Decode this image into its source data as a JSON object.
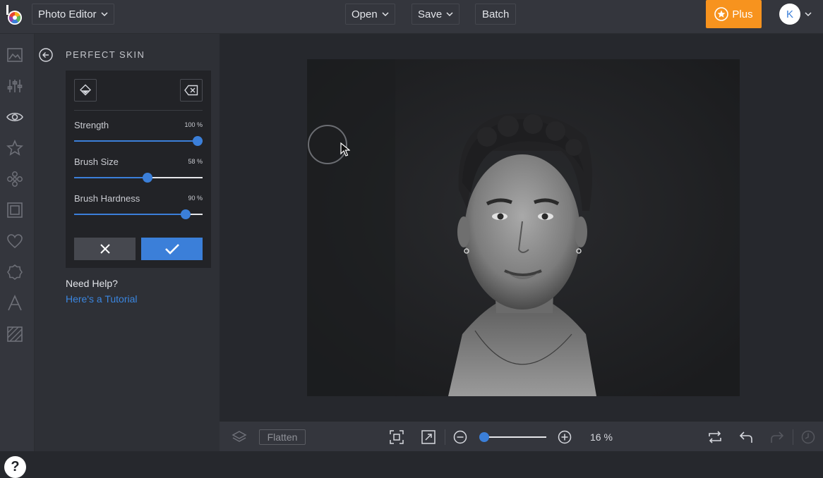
{
  "app": {
    "mode_label": "Photo Editor",
    "menu": {
      "open": "Open",
      "save": "Save",
      "batch": "Batch"
    },
    "plus_label": "Plus",
    "user_initial": "K"
  },
  "rail": {
    "icons": [
      "image-icon",
      "sliders-icon",
      "eye-icon",
      "star-icon",
      "flower-icon",
      "frame-icon",
      "heart-icon",
      "badge-icon",
      "text-icon",
      "texture-icon"
    ],
    "help_label": "?"
  },
  "panel": {
    "title": "PERFECT SKIN",
    "sliders": [
      {
        "label": "Strength",
        "value_text": "100 %",
        "value": 100
      },
      {
        "label": "Brush Size",
        "value_text": "58 %",
        "value": 58
      },
      {
        "label": "Brush Hardness",
        "value_text": "90 %",
        "value": 90
      }
    ],
    "help_title": "Need Help?",
    "help_link": "Here's a Tutorial"
  },
  "bottom": {
    "flatten_label": "Flatten",
    "zoom_text": "16 %",
    "zoom_value": 16
  },
  "colors": {
    "accent": "#3b7fd9",
    "plus": "#f7931e",
    "topbar": "#34363d",
    "canvas_bg": "#26282d"
  }
}
